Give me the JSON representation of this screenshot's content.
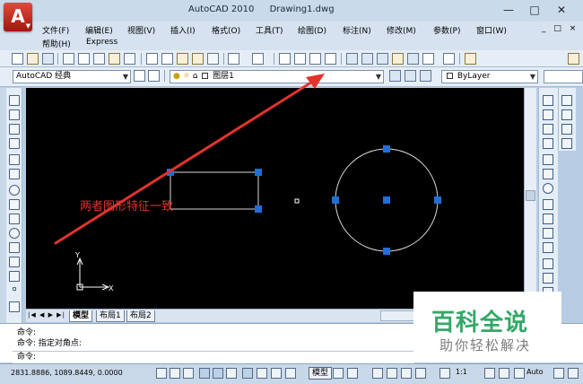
{
  "app": {
    "logo_letter": "A",
    "title_app": "AutoCAD 2010",
    "title_doc": "Drawing1.dwg"
  },
  "window_controls": {
    "minimize": "—",
    "maximize": "□",
    "close": "✕",
    "mdi": "_ □ ×"
  },
  "menu": {
    "row1": [
      "文件(F)",
      "编辑(E)",
      "视图(V)",
      "插入(I)",
      "格式(O)",
      "工具(T)",
      "绘图(D)",
      "标注(N)",
      "修改(M)",
      "参数(P)",
      "窗口(W)"
    ],
    "row2": [
      "帮助(H)",
      "Express"
    ]
  },
  "toolbar": {
    "workspace": "AutoCAD 经典",
    "layer": "图层1",
    "color": "ByLayer"
  },
  "canvas": {
    "annotation_text": "两者图形特征一致",
    "ucs_x": "X",
    "ucs_y": "Y",
    "background": "#000000",
    "grip_color": "#1f6fd6",
    "geometry_color": "#d8d8d8",
    "annotation_color": "#e2332c"
  },
  "tabs": {
    "nav": "|◀ ◀ ▶ ▶|",
    "items": [
      {
        "label": "模型",
        "active": true
      },
      {
        "label": "布局1",
        "active": false
      },
      {
        "label": "布局2",
        "active": false
      }
    ]
  },
  "command": {
    "history": [
      "命令:",
      "命令: 指定对角点:"
    ],
    "prompt": "命令:"
  },
  "status": {
    "coords": "2831.8886, 1089.8449, 0.0000",
    "model": "模型",
    "annotation_scale": "1:1",
    "auto": "Auto"
  },
  "watermark": {
    "title": "百科全说",
    "subtitle": "助你轻松解决"
  }
}
